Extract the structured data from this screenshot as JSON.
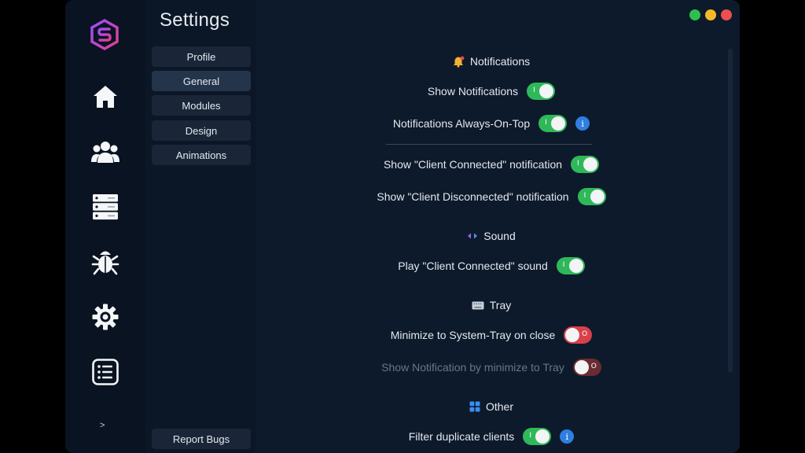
{
  "window": {
    "controls": [
      {
        "name": "maximize",
        "color": "#2fbf4f"
      },
      {
        "name": "minimize",
        "color": "#f5b928"
      },
      {
        "name": "close",
        "color": "#ec4f4f"
      }
    ]
  },
  "rail": {
    "items": [
      {
        "icon": "home-icon"
      },
      {
        "icon": "users-icon"
      },
      {
        "icon": "server-icon"
      },
      {
        "icon": "bug-icon"
      },
      {
        "icon": "gear-icon"
      },
      {
        "icon": "list-icon"
      }
    ],
    "expand_label": ">"
  },
  "menu": {
    "title": "Settings",
    "items": [
      {
        "label": "Profile",
        "active": false
      },
      {
        "label": "General",
        "active": true
      },
      {
        "label": "Modules",
        "active": false
      },
      {
        "label": "Design",
        "active": false
      },
      {
        "label": "Animations",
        "active": false
      }
    ],
    "report_label": "Report Bugs"
  },
  "sections": {
    "notifications": {
      "title": "Notifications",
      "icon": "bell-icon",
      "show_notifications": {
        "label": "Show Notifications",
        "enabled": true
      },
      "always_on_top": {
        "label": "Notifications Always-On-Top",
        "enabled": true
      },
      "client_connected": {
        "label": "Show \"Client Connected\" notification",
        "enabled": true
      },
      "client_disconnected": {
        "label": "Show \"Client Disconnected\" notification",
        "enabled": true
      }
    },
    "sound": {
      "title": "Sound",
      "icon": "sound-icon",
      "play_connected": {
        "label": "Play \"Client Connected\" sound",
        "enabled": true
      }
    },
    "tray": {
      "title": "Tray",
      "icon": "keyboard-icon",
      "minimize_tray": {
        "label": "Minimize to System-Tray on close",
        "enabled": false
      },
      "notify_minimize": {
        "label": "Show Notification by minimize to Tray",
        "enabled": false,
        "disabled": true
      }
    },
    "other": {
      "title": "Other",
      "icon": "windows-icon",
      "filter_duplicates": {
        "label": "Filter duplicate clients",
        "enabled": true
      }
    }
  },
  "toggle_marks": {
    "on": "I",
    "off": "O"
  },
  "info_mark": "i",
  "colors": {
    "accent_on": "#2fb85a",
    "accent_off": "#d8404a",
    "info": "#2f7fe0",
    "background": "#0d1a2b"
  }
}
